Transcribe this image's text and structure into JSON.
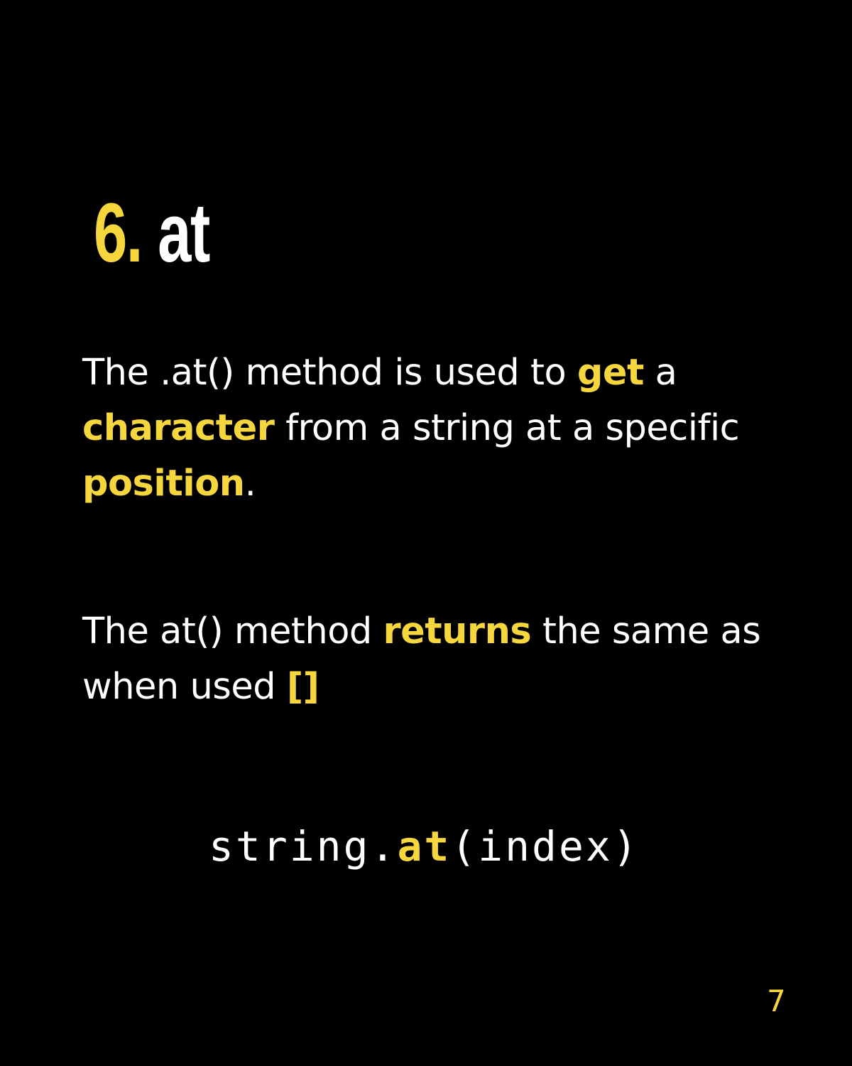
{
  "title": {
    "number": "6.",
    "word": "at"
  },
  "paragraph1": {
    "t1": "The .at() method is used to ",
    "h1": "get",
    "t2": " a ",
    "h2": "character",
    "t3": " from a string at a specific ",
    "h3": "position",
    "t4": "."
  },
  "paragraph2": {
    "t1": "The at() method ",
    "h1": "returns",
    "t2": " the same as when used ",
    "h2": "[]"
  },
  "code": {
    "pre": "string.",
    "keyword": "at",
    "post": "(index)"
  },
  "page_number": "7",
  "colors": {
    "background": "#000000",
    "text": "#ffffff",
    "accent": "#f5d63d"
  }
}
